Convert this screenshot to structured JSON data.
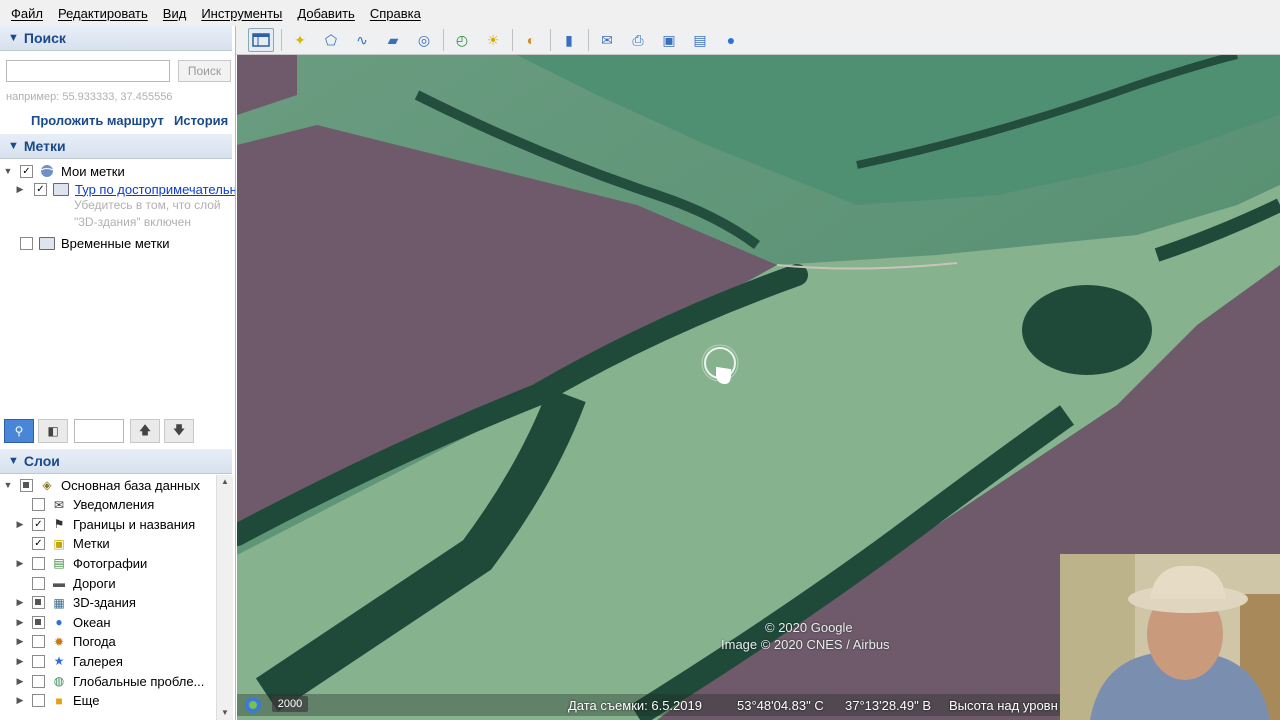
{
  "menu": [
    "Файл",
    "Редактировать",
    "Вид",
    "Инструменты",
    "Добавить",
    "Справка"
  ],
  "search": {
    "header": "Поиск",
    "input_value": "",
    "button": "Поиск",
    "hint": "например: 55.933333, 37.455556",
    "route_link": "Проложить маршрут",
    "history_link": "История"
  },
  "places": {
    "header": "Метки",
    "my_places": "Мои метки",
    "tour_link": "Тур по достопримечательностям",
    "tour_note_1": "Убедитесь в том, что слой",
    "tour_note_2": "\"3D-здания\" включен",
    "temp_places": "Временные метки"
  },
  "layers": {
    "header": "Слои",
    "items": [
      {
        "label": "Основная база данных",
        "checked": "partial",
        "expander": "▼",
        "icon": "database-icon"
      },
      {
        "label": "Уведомления",
        "checked": "",
        "expander": "",
        "icon": "envelope-icon"
      },
      {
        "label": "Границы и названия",
        "checked": "✓",
        "expander": "▶",
        "icon": "flag-icon"
      },
      {
        "label": "Метки",
        "checked": "✓",
        "expander": "",
        "icon": "placemark-icon"
      },
      {
        "label": "Фотографии",
        "checked": "",
        "expander": "▶",
        "icon": "photo-icon"
      },
      {
        "label": "Дороги",
        "checked": "",
        "expander": "",
        "icon": "road-icon"
      },
      {
        "label": "3D-здания",
        "checked": "partial",
        "expander": "▶",
        "icon": "building-icon"
      },
      {
        "label": "Океан",
        "checked": "partial",
        "expander": "▶",
        "icon": "ocean-icon"
      },
      {
        "label": "Погода",
        "checked": "",
        "expander": "▶",
        "icon": "weather-icon"
      },
      {
        "label": "Галерея",
        "checked": "",
        "expander": "▶",
        "icon": "gallery-icon"
      },
      {
        "label": "Глобальные пробле...",
        "checked": "",
        "expander": "▶",
        "icon": "globe-icon"
      },
      {
        "label": "Еще",
        "checked": "",
        "expander": "▶",
        "icon": "more-icon"
      }
    ]
  },
  "map": {
    "copyright_1": "© 2020 Google",
    "copyright_2": "Image © 2020 CNES / Airbus",
    "year": "2000",
    "capture_date": "Дата съемки: 6.5.2019",
    "lat": "53°48'04.83\" С",
    "lon": "37°13'28.49\" В",
    "elevation": "Высота над уровн"
  },
  "colors": {
    "field_purple": "#6e5a6a",
    "field_green": "#5f9a76",
    "forest": "#1f4a3a",
    "panel_header": "#1a4a8a"
  }
}
